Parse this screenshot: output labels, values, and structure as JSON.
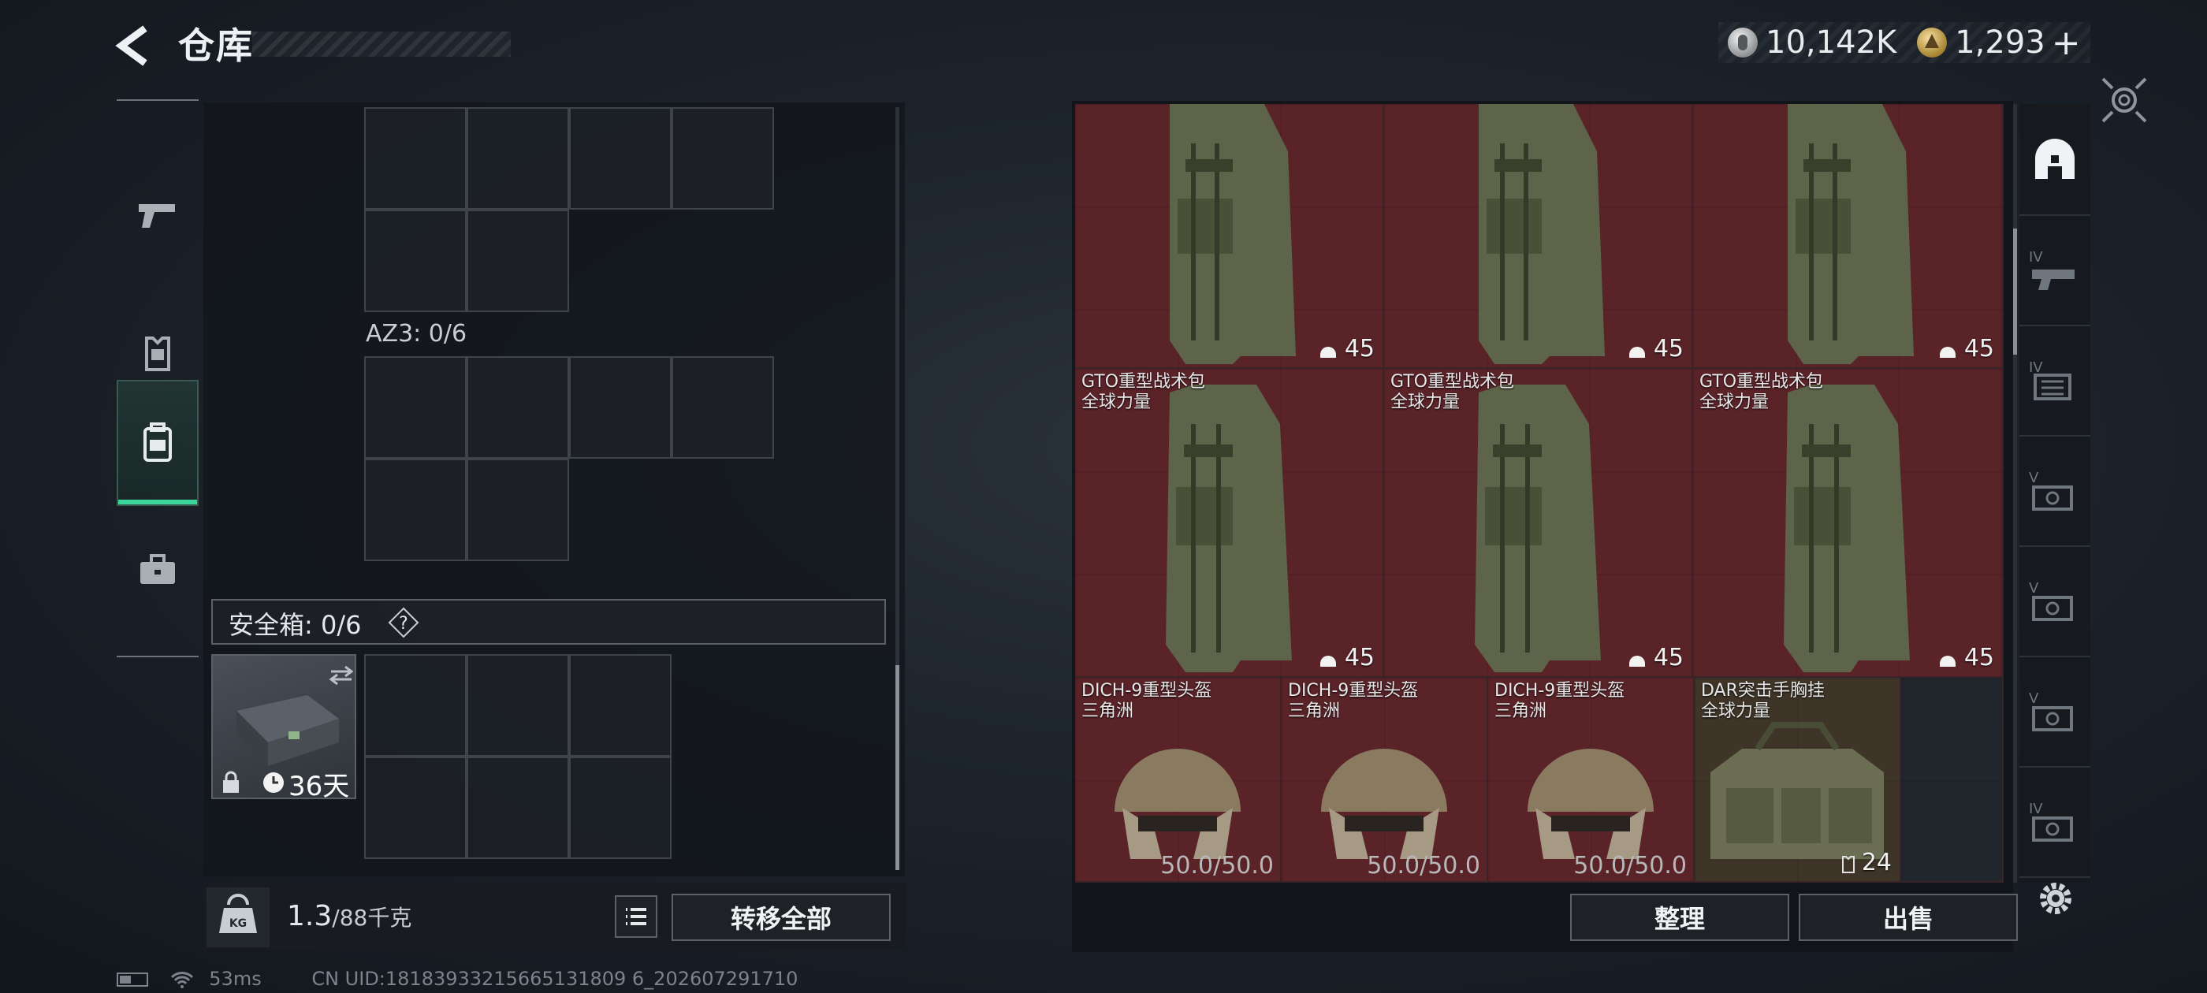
{
  "header": {
    "title": "仓库",
    "currencies": [
      {
        "icon": "silver-coin-icon",
        "value": "10,142K"
      },
      {
        "icon": "gold-coin-icon",
        "value": "1,293"
      }
    ],
    "add_label": "+"
  },
  "sidebar": {
    "items": [
      {
        "icon": "pistol-icon",
        "active": false
      },
      {
        "icon": "armor-vest-icon",
        "active": false
      },
      {
        "icon": "backpack-icon",
        "active": true
      },
      {
        "icon": "briefcase-icon",
        "active": false
      }
    ]
  },
  "left_panel": {
    "containers": [
      {
        "label": "AZ3: 0/6"
      }
    ],
    "safebox": {
      "label": "安全箱: 0/6",
      "help": "?",
      "timer": "36天"
    },
    "weight": {
      "current": "1.3",
      "max": "/88千克"
    },
    "transfer_all": "转移全部"
  },
  "right_panel": {
    "items": [
      {
        "name": "",
        "faction": "",
        "qty": "45",
        "kind": "backpack"
      },
      {
        "name": "",
        "faction": "",
        "qty": "45",
        "kind": "backpack"
      },
      {
        "name": "",
        "faction": "",
        "qty": "45",
        "kind": "backpack"
      },
      {
        "name": "GTO重型战术包",
        "faction": "全球力量",
        "qty": "45",
        "kind": "backpack"
      },
      {
        "name": "GTO重型战术包",
        "faction": "全球力量",
        "qty": "45",
        "kind": "backpack"
      },
      {
        "name": "GTO重型战术包",
        "faction": "全球力量",
        "qty": "45",
        "kind": "backpack"
      },
      {
        "name": "DICH-9重型头盔",
        "faction": "三角洲",
        "durability": "50.0/50.0",
        "kind": "helmet"
      },
      {
        "name": "DICH-9重型头盔",
        "faction": "三角洲",
        "durability": "50.0/50.0",
        "kind": "helmet"
      },
      {
        "name": "DICH-9重型头盔",
        "faction": "三角洲",
        "durability": "50.0/50.0",
        "kind": "helmet"
      },
      {
        "name": "DAR突击手胸挂",
        "faction": "全球力量",
        "qty": "24",
        "kind": "rig"
      }
    ],
    "sort_label": "整理",
    "sell_label": "出售"
  },
  "right_tabs": [
    {
      "icon": "helmet-category-icon",
      "tier": ""
    },
    {
      "icon": "tier-iv-item-icon",
      "tier": "IV"
    },
    {
      "icon": "tier-iv-item-icon",
      "tier": "IV"
    },
    {
      "icon": "tier-v-item-icon",
      "tier": "V"
    },
    {
      "icon": "tier-v-item-icon",
      "tier": "V"
    },
    {
      "icon": "tier-v-item-icon",
      "tier": "V"
    },
    {
      "icon": "tier-iv-item-icon",
      "tier": "IV"
    }
  ],
  "status_bar": {
    "ping": "53ms",
    "uid": "CN UID:18183933215665131809 6_202607291710"
  },
  "colors": {
    "accent": "#39d59a",
    "item_bg": "#5a2328",
    "rig_bg": "#3e3528"
  }
}
